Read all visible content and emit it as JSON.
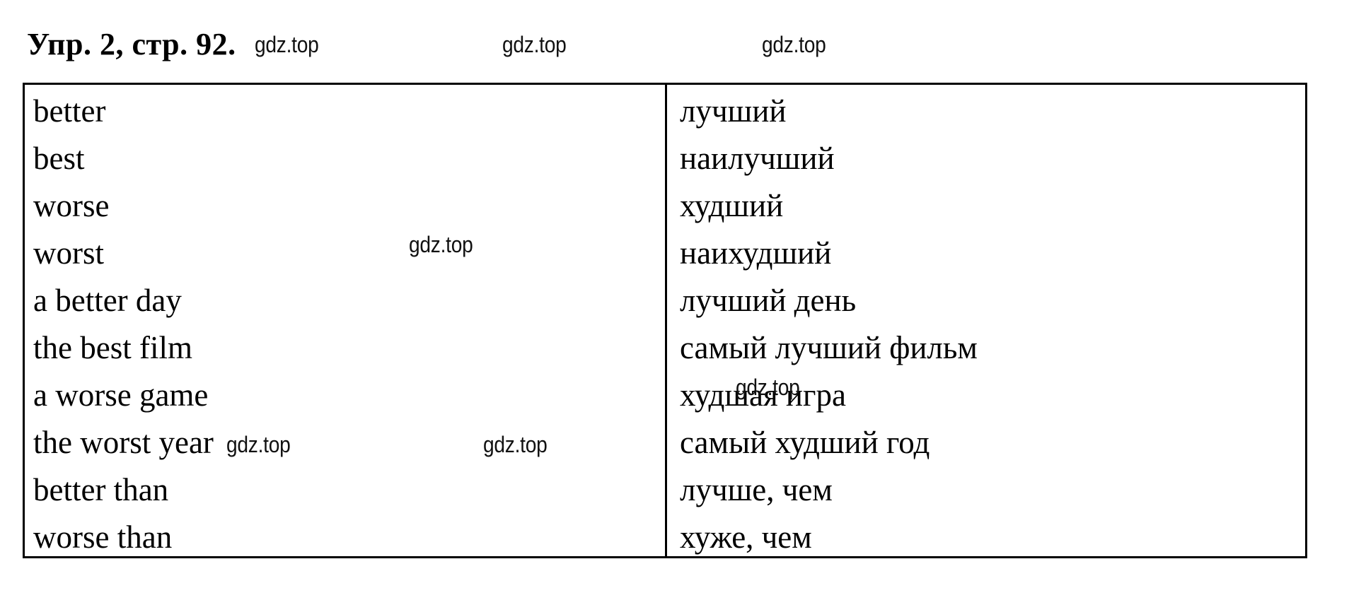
{
  "page": {
    "title": "Упр. 2, стр. 92.",
    "background_color": "#ffffff",
    "text_color": "#000000",
    "border_color": "#000000"
  },
  "table": {
    "columns": 2,
    "rows": [
      {
        "english": "better",
        "russian": "лучший"
      },
      {
        "english": "best",
        "russian": "наилучший"
      },
      {
        "english": "worse",
        "russian": "худший"
      },
      {
        "english": "worst",
        "russian": "наихудший"
      },
      {
        "english": "a better day",
        "russian": "лучший день"
      },
      {
        "english": "the best film",
        "russian": "самый лучший фильм"
      },
      {
        "english": "a worse game",
        "russian": "худшая игра"
      },
      {
        "english": "the worst year",
        "russian": "самый худший год"
      },
      {
        "english": "better than",
        "russian": "лучше, чем"
      },
      {
        "english": "worse than",
        "russian": "хуже, чем"
      }
    ]
  },
  "watermarks": [
    {
      "text": "gdz.top"
    },
    {
      "text": "gdz.top"
    },
    {
      "text": "gdz.top"
    },
    {
      "text": "gdz.top"
    },
    {
      "text": "gdz.top"
    },
    {
      "text": "gdz.top"
    },
    {
      "text": "gdz.top"
    }
  ]
}
